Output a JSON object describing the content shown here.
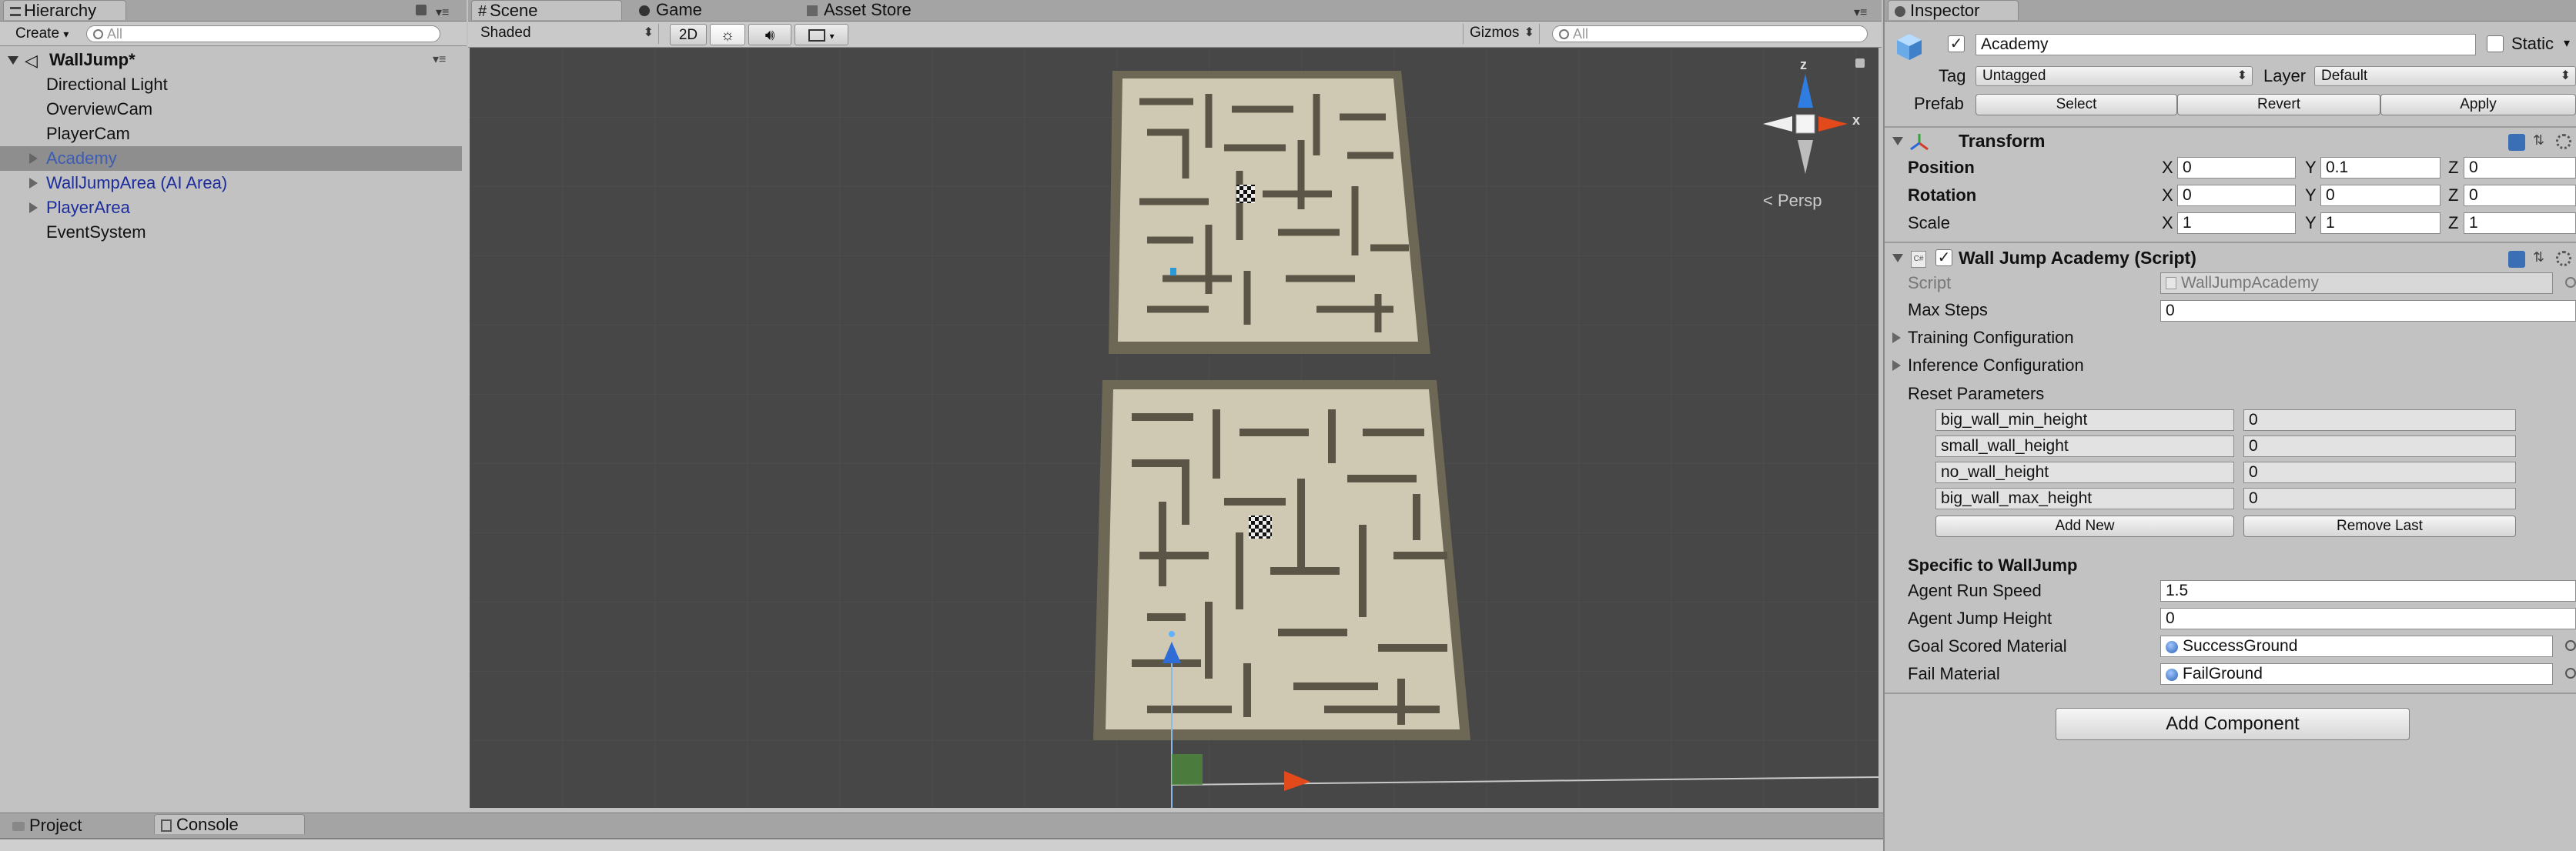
{
  "hierarchy": {
    "tab_label": "Hierarchy",
    "create_label": "Create",
    "search_placeholder": "All",
    "scene_name": "WallJump*",
    "items": [
      {
        "label": "Directional Light"
      },
      {
        "label": "OverviewCam"
      },
      {
        "label": "PlayerCam"
      },
      {
        "label": "Academy"
      },
      {
        "label": "WallJumpArea (AI Area)"
      },
      {
        "label": "PlayerArea"
      },
      {
        "label": "EventSystem"
      }
    ]
  },
  "scene_view": {
    "tabs": [
      "Scene",
      "Game",
      "Asset Store"
    ],
    "shading_mode": "Shaded",
    "mode_2d": "2D",
    "gizmos_label": "Gizmos",
    "search_placeholder": "All",
    "gizmo_x": "x",
    "gizmo_z": "z",
    "projection_label": "Persp"
  },
  "bottom_panel": {
    "tabs": [
      "Project",
      "Console"
    ]
  },
  "inspector": {
    "tab_label": "Inspector",
    "object_name": "Academy",
    "static_label": "Static",
    "tag_label": "Tag",
    "tag_value": "Untagged",
    "layer_label": "Layer",
    "layer_value": "Default",
    "prefab_label": "Prefab",
    "prefab_buttons": [
      "Select",
      "Revert",
      "Apply"
    ],
    "transform": {
      "title": "Transform",
      "rows": [
        {
          "label": "Position",
          "x": "0",
          "y": "0.1",
          "z": "0"
        },
        {
          "label": "Rotation",
          "x": "0",
          "y": "0",
          "z": "0"
        },
        {
          "label": "Scale",
          "x": "1",
          "y": "1",
          "z": "1"
        }
      ],
      "axis_x": "X",
      "axis_y": "Y",
      "axis_z": "Z"
    },
    "script_component": {
      "title": "Wall Jump Academy (Script)",
      "script_label": "Script",
      "script_value": "WallJumpAcademy",
      "max_steps_label": "Max Steps",
      "max_steps_value": "0",
      "training_config_label": "Training Configuration",
      "inference_config_label": "Inference Configuration",
      "reset_params_label": "Reset Parameters",
      "reset_params": [
        {
          "key": "big_wall_min_height",
          "value": "0"
        },
        {
          "key": "small_wall_height",
          "value": "0"
        },
        {
          "key": "no_wall_height",
          "value": "0"
        },
        {
          "key": "big_wall_max_height",
          "value": "0"
        }
      ],
      "add_new_label": "Add New",
      "remove_last_label": "Remove Last",
      "specific_header": "Specific to WallJump",
      "agent_run_speed_label": "Agent Run Speed",
      "agent_run_speed_value": "1.5",
      "agent_jump_height_label": "Agent Jump Height",
      "agent_jump_height_value": "0",
      "goal_material_label": "Goal Scored Material",
      "goal_material_value": "SuccessGround",
      "fail_material_label": "Fail Material",
      "fail_material_value": "FailGround"
    },
    "add_component_label": "Add Component"
  }
}
